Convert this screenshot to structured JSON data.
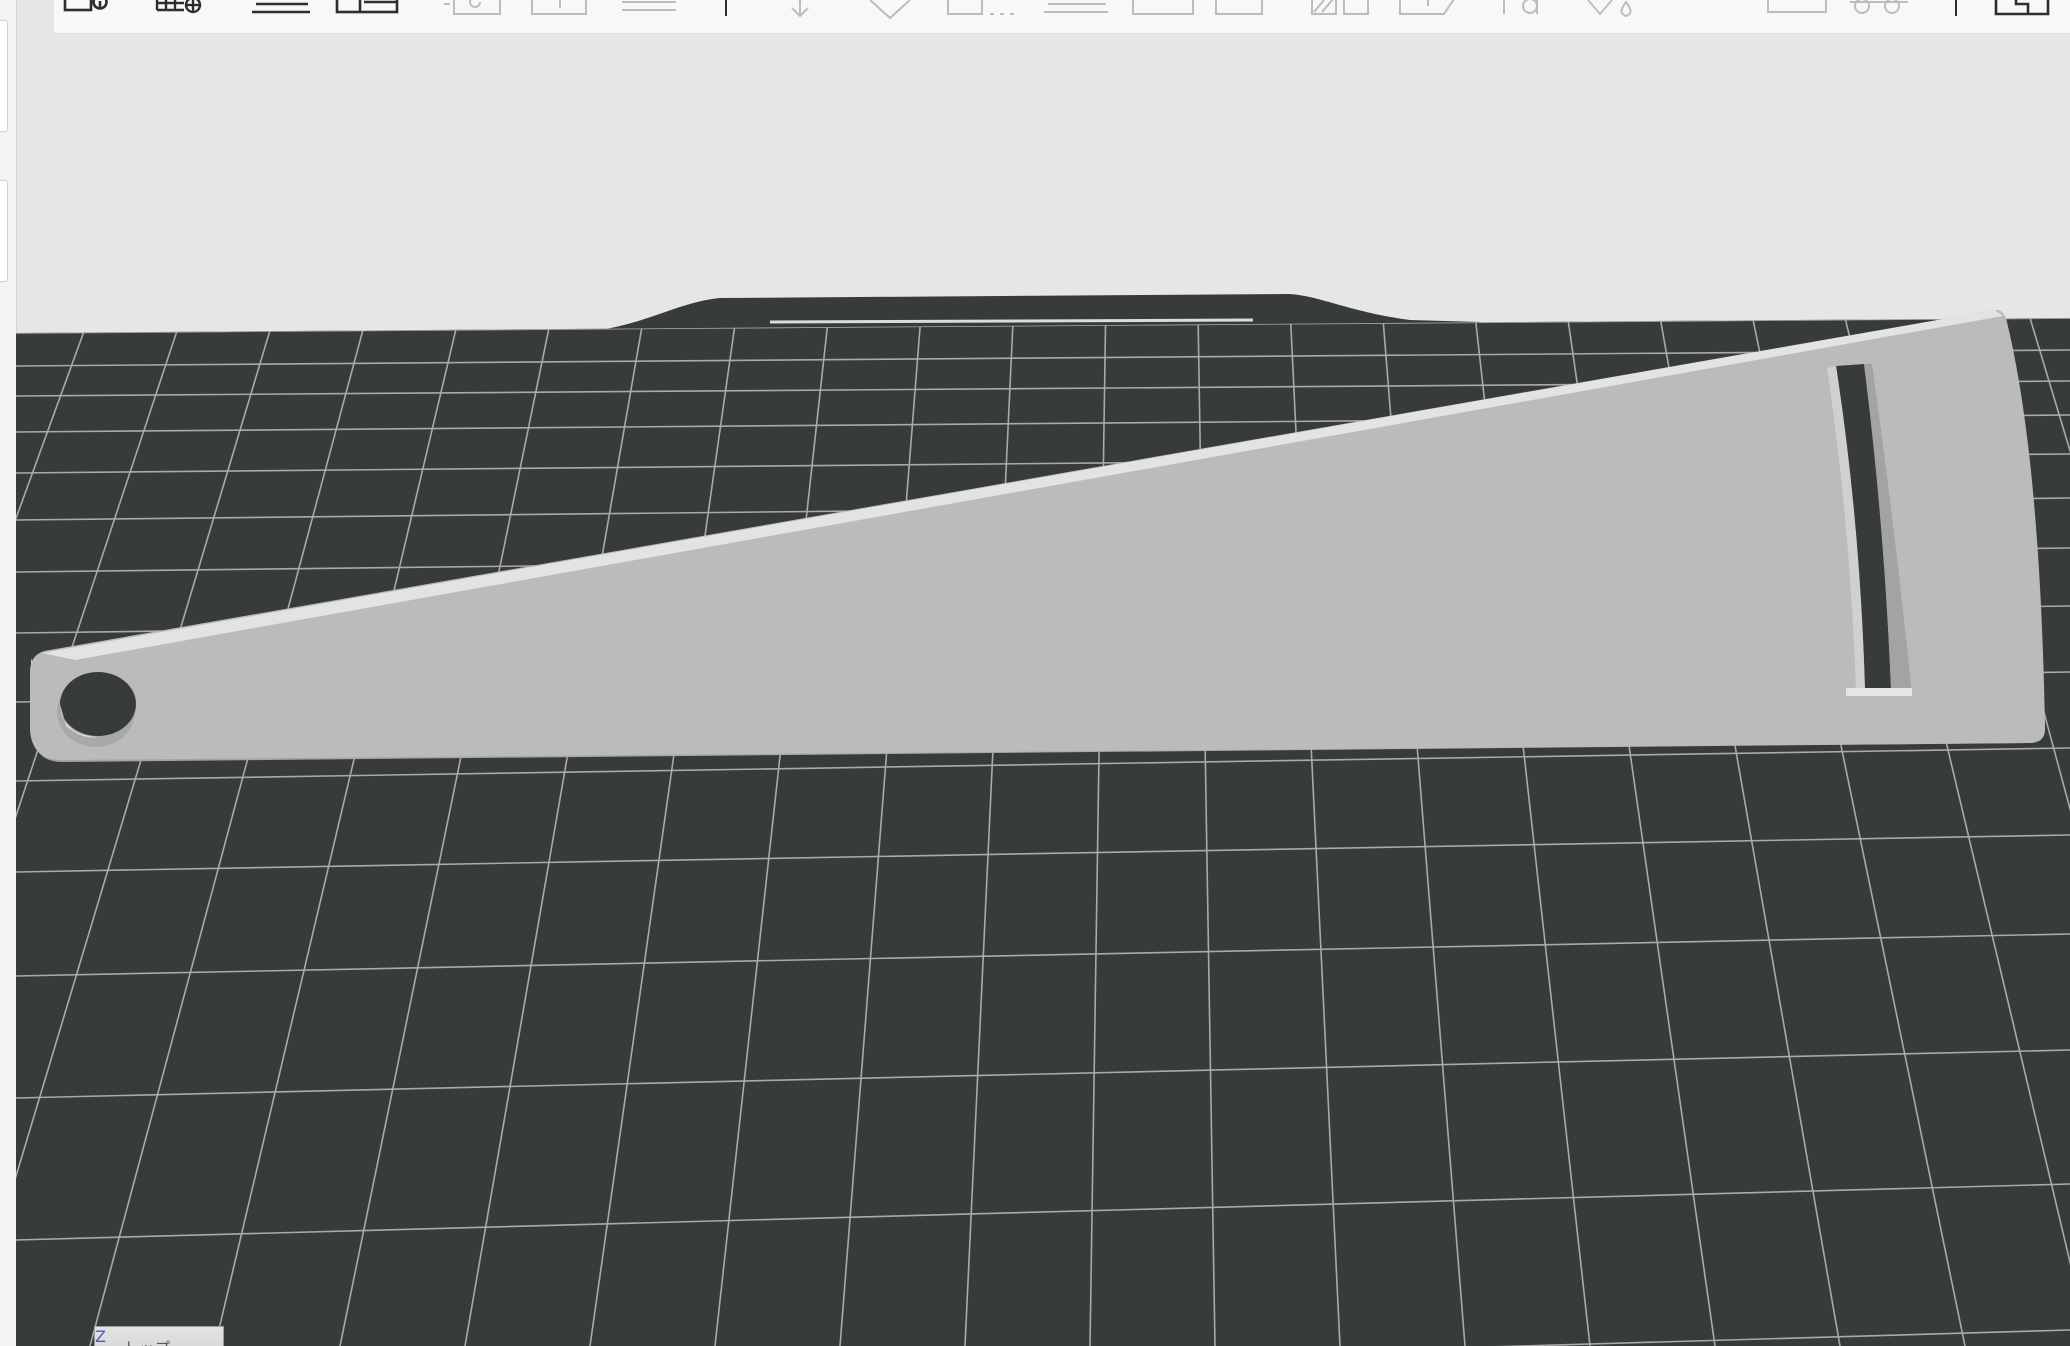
{
  "viewport": {
    "nav_cube": {
      "label": "トップ",
      "axis_label": "Z"
    }
  },
  "toolbar": {
    "icons": [
      {
        "name": "add-object-info-icon",
        "enabled": true
      },
      {
        "name": "add-plate-icon",
        "enabled": true
      },
      {
        "name": "auto-orient-icon",
        "enabled": true
      },
      {
        "name": "arrange-icon",
        "enabled": true
      },
      {
        "name": "rotate-icon",
        "enabled": false
      },
      {
        "name": "scale-icon",
        "enabled": false
      },
      {
        "name": "lay-on-face-icon",
        "enabled": false
      },
      {
        "name": "place-on-bed-icon",
        "enabled": false
      },
      {
        "name": "support-paint-icon",
        "enabled": false
      },
      {
        "name": "cut-icon",
        "enabled": false
      },
      {
        "name": "measure-icon",
        "enabled": false
      },
      {
        "name": "split-objects-icon",
        "enabled": false
      },
      {
        "name": "split-parts-icon",
        "enabled": false
      },
      {
        "name": "seam-paint-icon",
        "enabled": false
      },
      {
        "name": "text-emboss-icon",
        "enabled": false
      },
      {
        "name": "svg-emboss-icon",
        "enabled": false
      },
      {
        "name": "fuzzy-paint-icon",
        "enabled": false
      },
      {
        "name": "assembly-view-icon",
        "enabled": false
      },
      {
        "name": "variable-layer-height-icon",
        "enabled": false
      },
      {
        "name": "layers-view-icon",
        "enabled": true
      }
    ]
  },
  "colors": {
    "background": "#e6e6e6",
    "bed": "#383b3c",
    "grid_line": "#a8aaab",
    "model_top": "#bbbbbb",
    "model_edge": "#e3e3e3"
  }
}
